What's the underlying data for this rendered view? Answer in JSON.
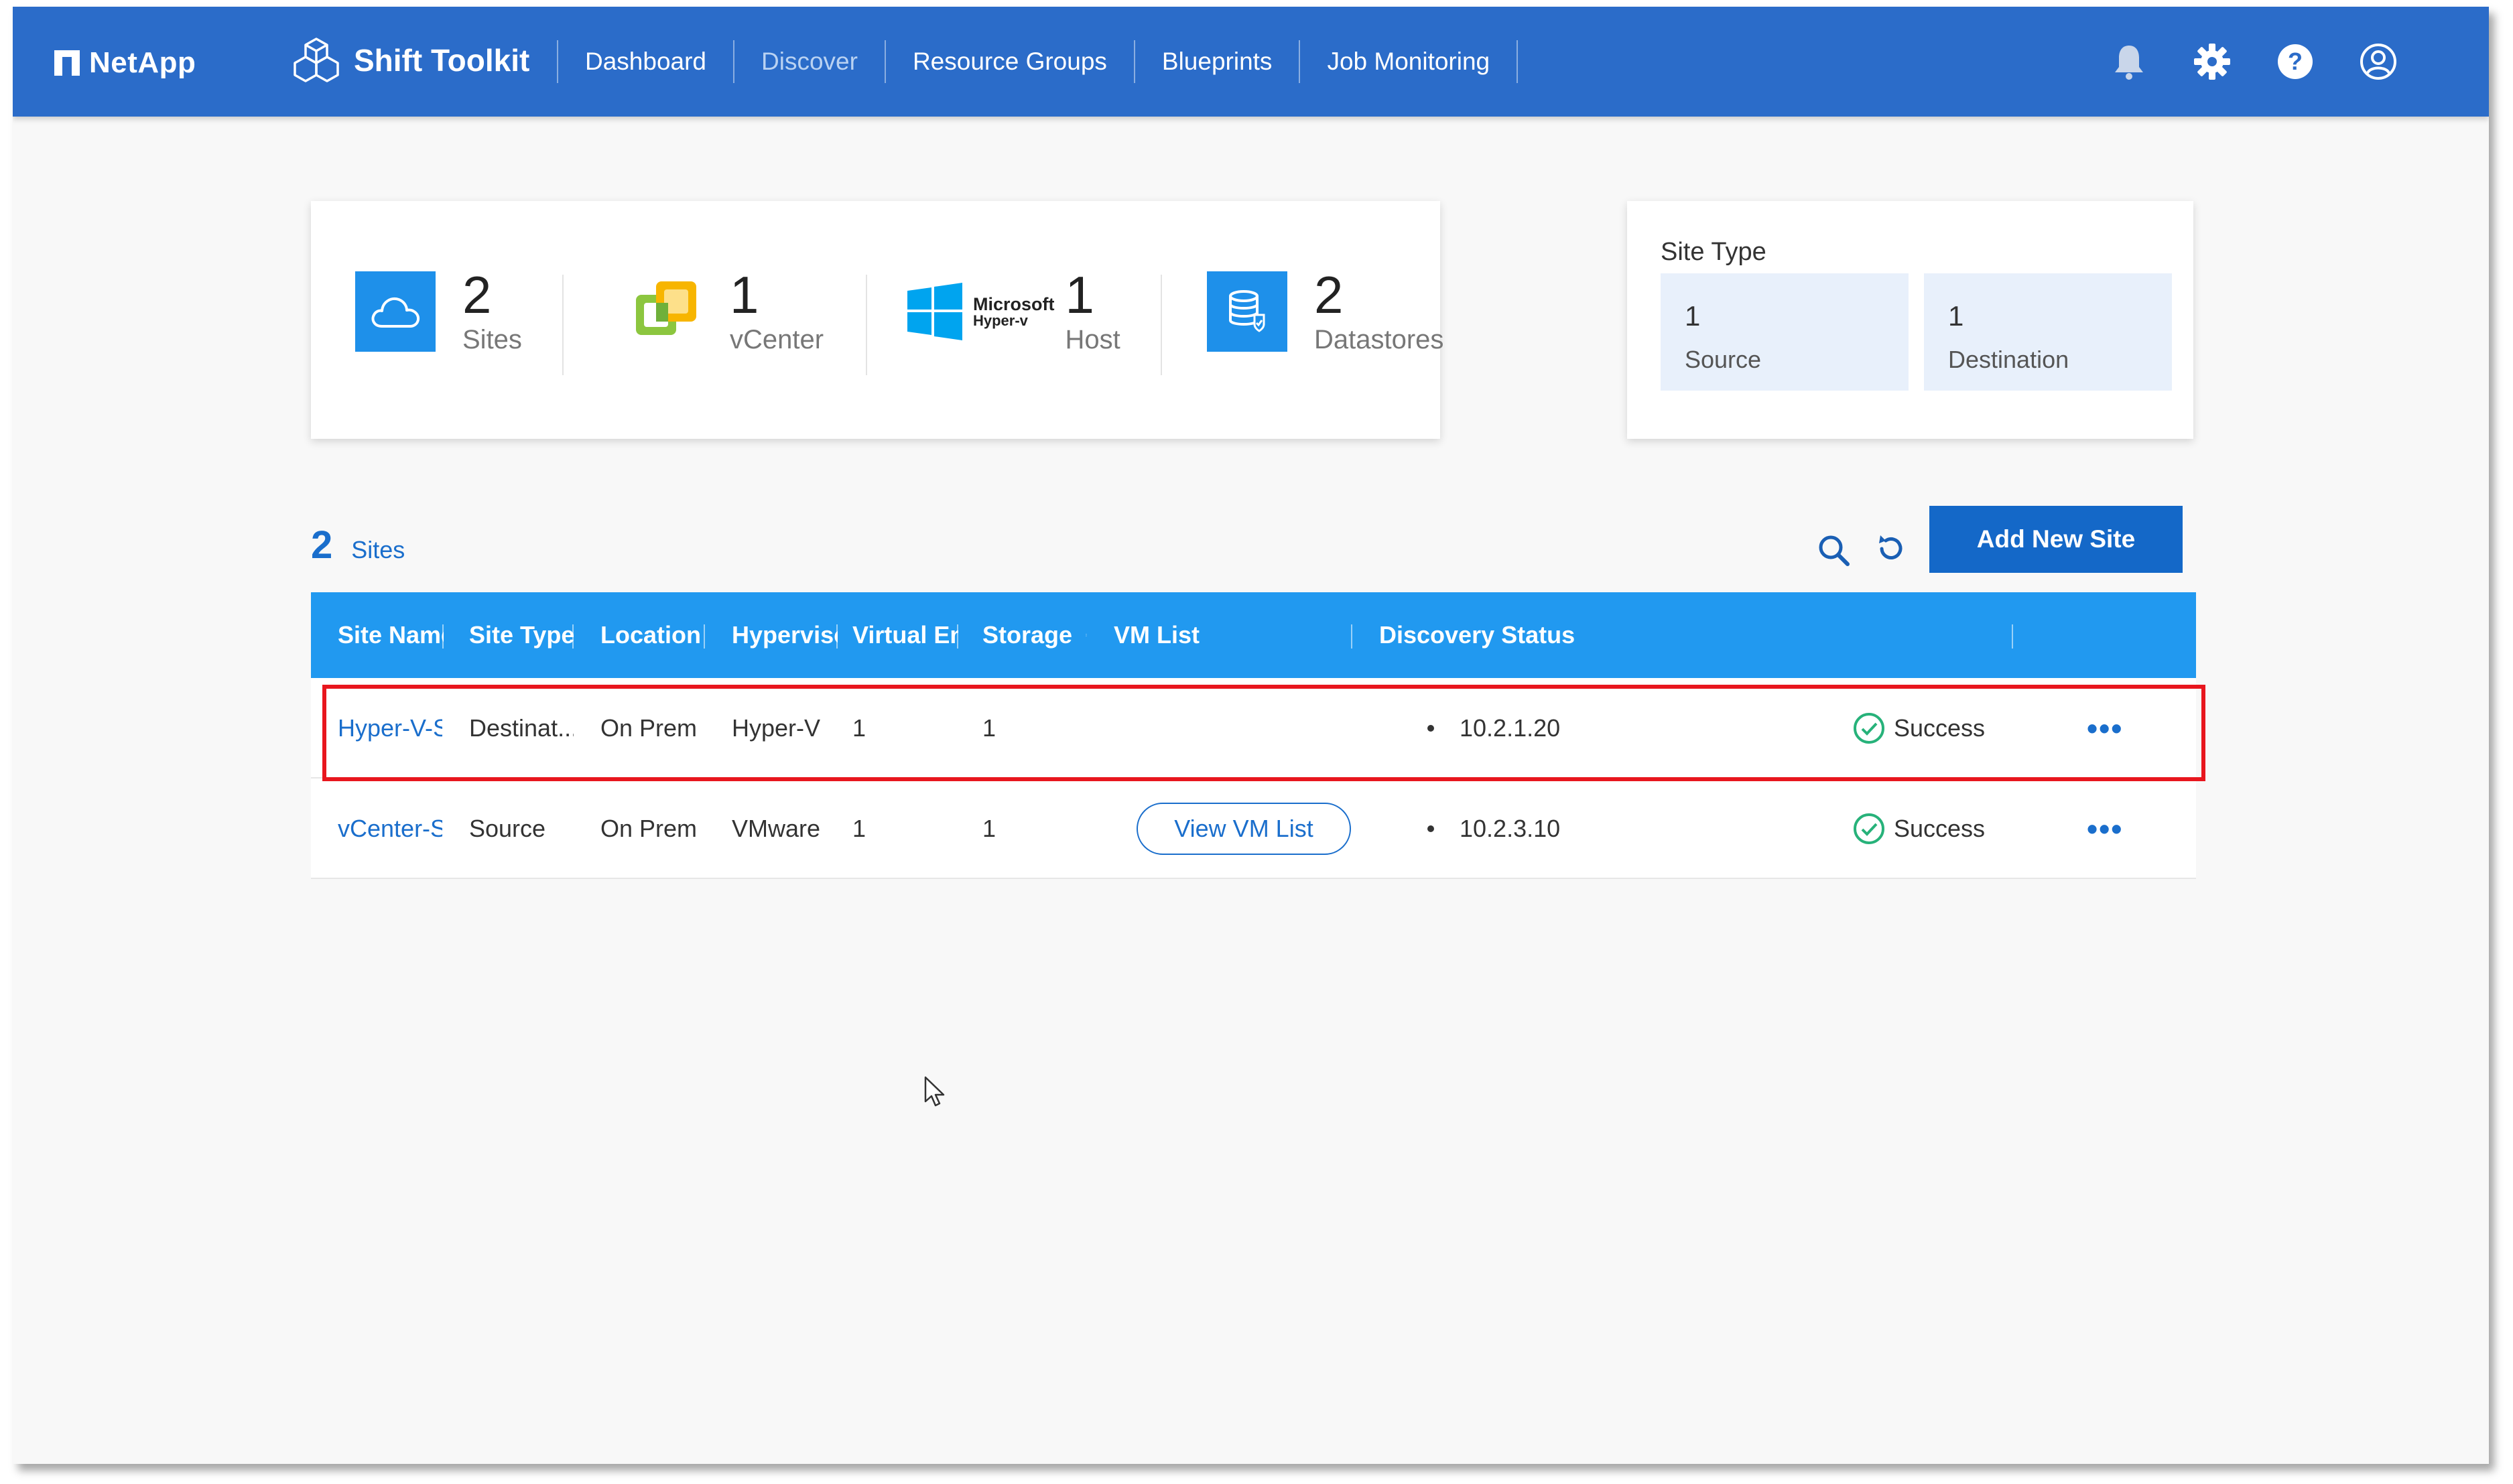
{
  "header": {
    "brand": "NetApp",
    "product": "Shift Toolkit",
    "nav": [
      "Dashboard",
      "Discover",
      "Resource Groups",
      "Blueprints",
      "Job Monitoring"
    ],
    "active_nav": "Discover",
    "icons": [
      "bell-icon",
      "gear-icon",
      "help-icon",
      "user-icon"
    ]
  },
  "summary": {
    "sites": {
      "count": "2",
      "label": "Sites"
    },
    "vcenter": {
      "count": "1",
      "label": "vCenter"
    },
    "host": {
      "count": "1",
      "label": "Host",
      "logo_line1": "Microsoft",
      "logo_line2": "Hyper-v"
    },
    "datastores": {
      "count": "2",
      "label": "Datastores"
    }
  },
  "site_type": {
    "title": "Site Type",
    "source": {
      "count": "1",
      "label": "Source"
    },
    "destination": {
      "count": "1",
      "label": "Destination"
    }
  },
  "sites_header": {
    "count": "2",
    "label": "Sites",
    "add_button": "Add New Site"
  },
  "table": {
    "columns": [
      "Site Name",
      "Site Type",
      "Location",
      "Hypervisor",
      "Virtual Env",
      "Storage",
      "VM List",
      "Discovery Status"
    ],
    "rows": [
      {
        "name": "Hyper-V-S",
        "type": "Destinat...",
        "location": "On Prem",
        "hypervisor": "Hyper-V",
        "virtual_env": "1",
        "storage": "1",
        "vm_list": "",
        "ip": "10.2.1.20",
        "status": "Success"
      },
      {
        "name": "vCenter-Si",
        "type": "Source",
        "location": "On Prem",
        "hypervisor": "VMware",
        "virtual_env": "1",
        "storage": "1",
        "vm_list": "View VM List",
        "ip": "10.2.3.10",
        "status": "Success"
      }
    ]
  },
  "colors": {
    "topbar": "#2b6cc9",
    "table_header": "#2199f0",
    "accent": "#1a6ecc",
    "success": "#27b27a",
    "highlight": "#e8161e"
  }
}
